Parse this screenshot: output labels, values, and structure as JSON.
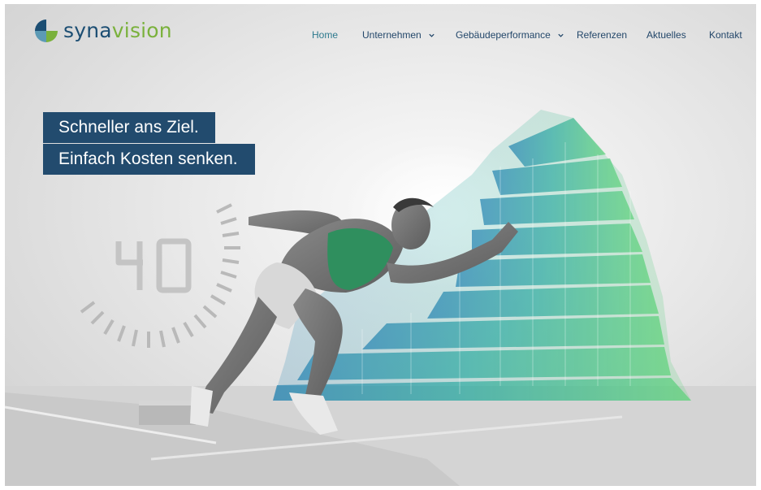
{
  "brand": {
    "name_part1": "syna",
    "name_part2": "vision",
    "colors": {
      "navy": "#1c4e73",
      "green": "#7ab13c",
      "teal": "#2e7a8e"
    }
  },
  "nav": {
    "items": [
      {
        "label": "Home",
        "active": true,
        "dropdown": false
      },
      {
        "label": "Unternehmen",
        "active": false,
        "dropdown": true
      },
      {
        "label": "Gebäudeperformance",
        "active": false,
        "dropdown": true
      },
      {
        "label": "Referenzen",
        "active": false,
        "dropdown": false
      },
      {
        "label": "Aktuelles",
        "active": false,
        "dropdown": false
      },
      {
        "label": "Kontakt",
        "active": false,
        "dropdown": false
      }
    ]
  },
  "hero": {
    "headline_line1": "Schneller ans Ziel.",
    "headline_line2": "Einfach Kosten senken.",
    "timer_digits": "40",
    "image_subject": "sprinter-in-starting-position-with-glass-building"
  }
}
